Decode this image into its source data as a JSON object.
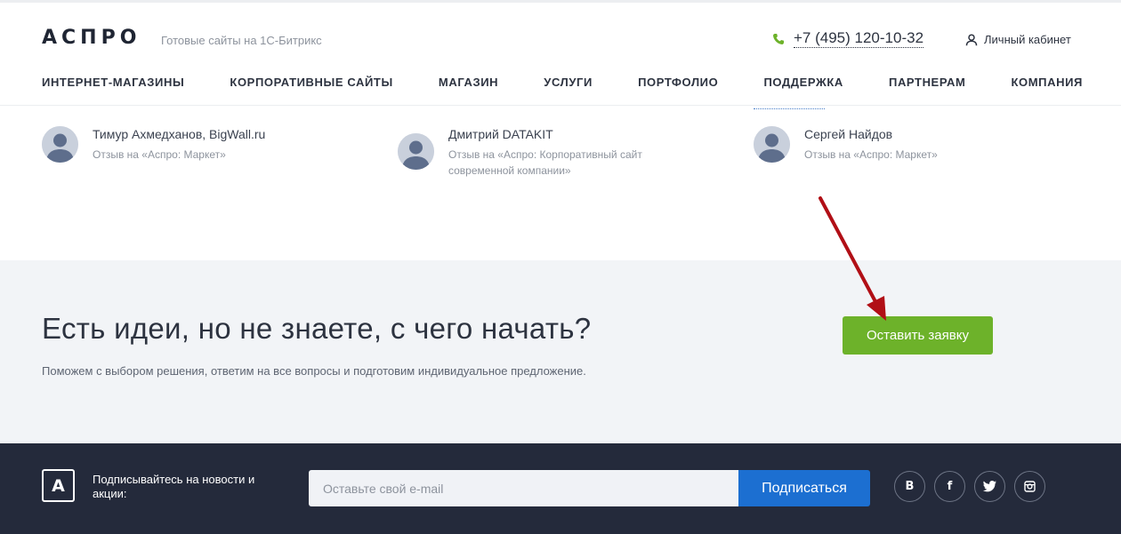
{
  "header": {
    "logo": "АСПРО",
    "tagline": "Готовые сайты на 1С-Битрикс",
    "phone": "+7 (495) 120-10-32",
    "cabinet_label": "Личный кабинет",
    "nav": [
      {
        "label": "ИНТЕРНЕТ-МАГАЗИНЫ"
      },
      {
        "label": "КОРПОРАТИВНЫЕ САЙТЫ"
      },
      {
        "label": "МАГАЗИН"
      },
      {
        "label": "УСЛУГИ"
      },
      {
        "label": "ПОРТФОЛИО"
      },
      {
        "label": "ПОДДЕРЖКА"
      },
      {
        "label": "ПАРТНЕРАМ"
      },
      {
        "label": "КОМПАНИЯ"
      }
    ]
  },
  "reviews": [
    {
      "author": "Тимур Ахмедханов, BigWall.ru",
      "source": "Отзыв на «Аспро: Маркет»"
    },
    {
      "author": "Дмитрий DATAKIT",
      "source": "Отзыв на «Аспро: Корпоративный сайт современной компании»"
    },
    {
      "author": "Сергей Найдов",
      "source": "Отзыв на «Аспро: Маркет»"
    }
  ],
  "cta": {
    "title": "Есть идеи, но не знаете, с чего начать?",
    "subtitle": "Поможем с выбором решения, ответим на все вопросы и подготовим индивидуальное предложение.",
    "button_label": "Оставить заявку"
  },
  "footer": {
    "logo_letter": "A",
    "subscribe_text": "Подписывайтесь на новости и акции:",
    "email_placeholder": "Оставьте свой e-mail",
    "subscribe_button": "Подписаться",
    "socials": [
      {
        "name": "vk-icon",
        "glyph": "В"
      },
      {
        "name": "facebook-icon",
        "glyph": "f"
      },
      {
        "name": "twitter-icon",
        "glyph": ""
      },
      {
        "name": "instagram-icon",
        "glyph": ""
      }
    ]
  },
  "colors": {
    "accent_green": "#6db22a",
    "accent_blue": "#1c6fd1",
    "footer_bg": "#242a3b",
    "cta_bg": "#f2f4f7",
    "arrow": "#b10f16"
  }
}
